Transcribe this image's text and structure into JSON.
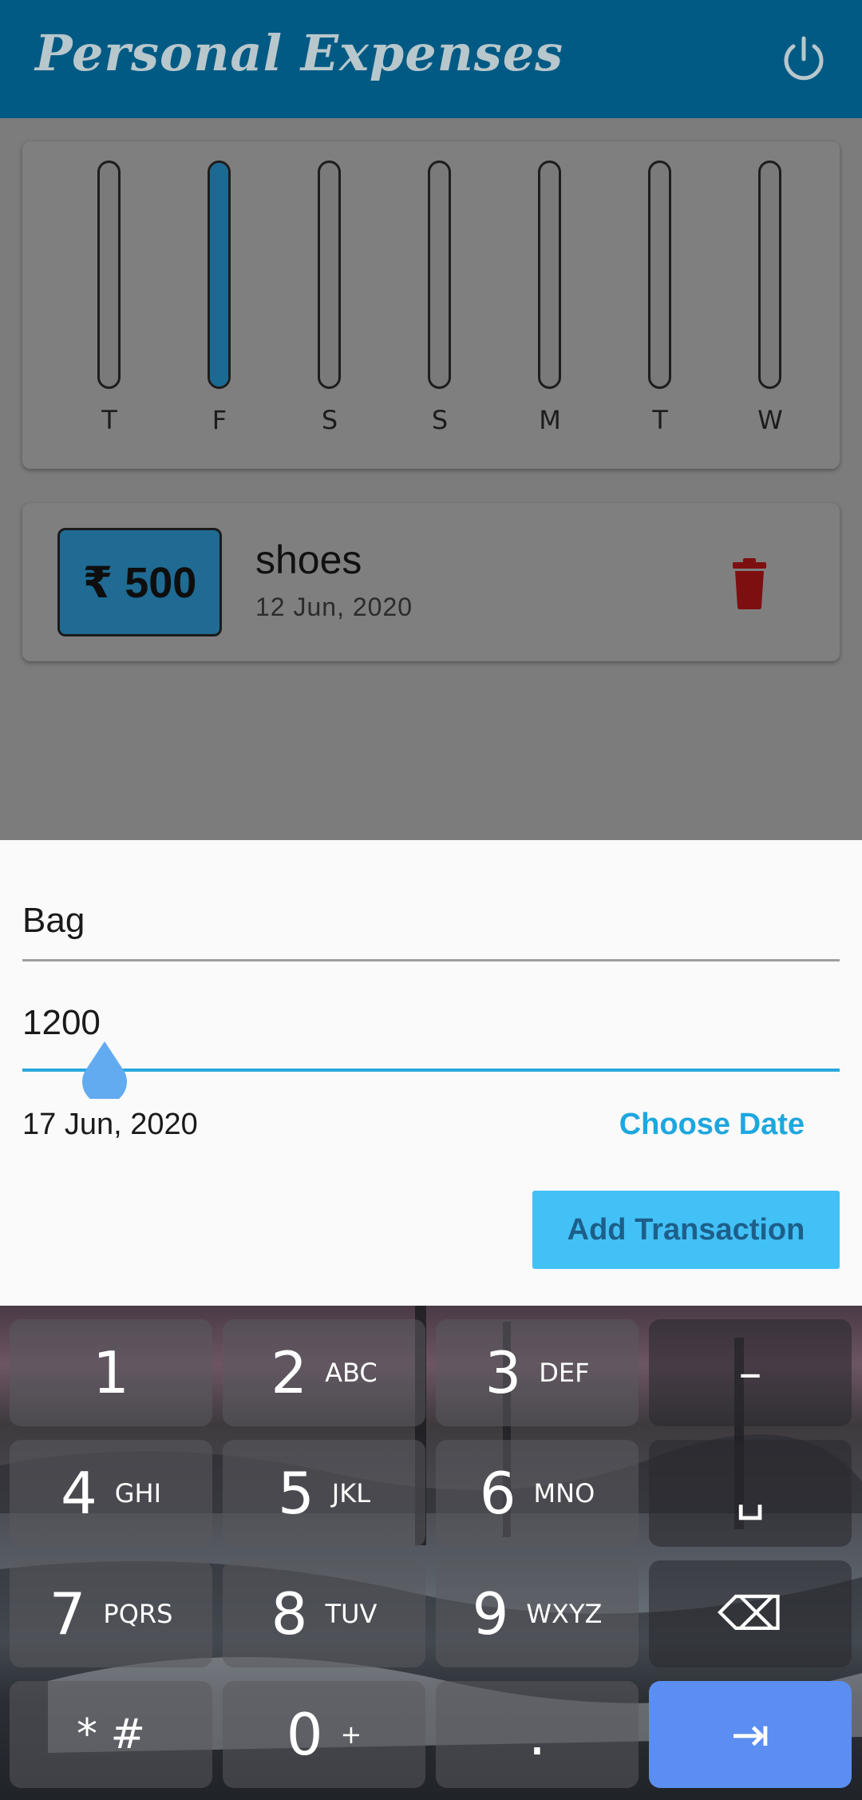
{
  "app": {
    "title": "Personal Expenses"
  },
  "chart_data": {
    "type": "bar",
    "categories": [
      "T",
      "F",
      "S",
      "S",
      "M",
      "T",
      "W"
    ],
    "values": [
      0,
      500,
      0,
      0,
      0,
      0,
      0
    ],
    "ylim": [
      0,
      500
    ]
  },
  "transaction": {
    "amount": "₹ 500",
    "title": "shoes",
    "date": "12 Jun, 2020"
  },
  "form": {
    "title_value": "Bag",
    "amount_value": "1200",
    "date_text": "17 Jun, 2020",
    "choose_date_label": "Choose Date",
    "add_button_label": "Add Transaction"
  },
  "keyboard": {
    "rows": [
      [
        {
          "main": "1",
          "sub": ""
        },
        {
          "main": "2",
          "sub": "ABC"
        },
        {
          "main": "3",
          "sub": "DEF"
        },
        {
          "main": "–",
          "sub": ""
        }
      ],
      [
        {
          "main": "4",
          "sub": "GHI"
        },
        {
          "main": "5",
          "sub": "JKL"
        },
        {
          "main": "6",
          "sub": "MNO"
        },
        {
          "main": "␣",
          "sub": ""
        }
      ],
      [
        {
          "main": "7",
          "sub": "PQRS"
        },
        {
          "main": "8",
          "sub": "TUV"
        },
        {
          "main": "9",
          "sub": "WXYZ"
        },
        {
          "main": "⌫",
          "sub": ""
        }
      ],
      [
        {
          "main": "* #",
          "sub": ""
        },
        {
          "main": "0",
          "sub": "+"
        },
        {
          "main": ".",
          "sub": ""
        },
        {
          "main": "⇥",
          "sub": ""
        }
      ]
    ]
  },
  "colors": {
    "app_bar": "#015a84",
    "accent": "#29a8dd",
    "add_button": "#42c1f7",
    "delete": "#7d0f10",
    "bar_fill": "#1b6a93"
  }
}
